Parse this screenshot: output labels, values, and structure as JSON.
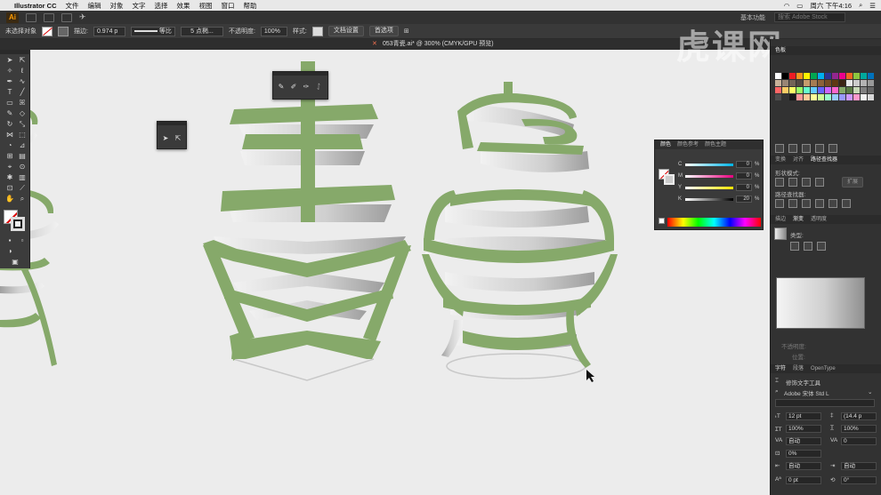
{
  "menubar": {
    "app_name": "Illustrator CC",
    "items": [
      "文件",
      "编辑",
      "对象",
      "文字",
      "选择",
      "效果",
      "视图",
      "窗口",
      "帮助"
    ],
    "clock": "周六 下午4:16"
  },
  "appbar": {
    "logo": "Ai",
    "workspace": "基本功能",
    "stock_placeholder": "搜索 Adobe Stock"
  },
  "controlbar": {
    "selection_status": "未选择对象",
    "stroke_label": "描边:",
    "stroke_value": "0.974 p",
    "profile": "等比",
    "brush": "5 点椭...",
    "opacity_label": "不透明度:",
    "opacity_value": "100%",
    "style_label": "样式:",
    "doc_setup": "文档设置",
    "preferences": "首选项"
  },
  "document": {
    "tab_title": "053青瓷.ai* @ 300% (CMYK/GPU 预览)",
    "close_glyph": "✕"
  },
  "watermark": "虎课网",
  "colors": {
    "ribbon_green": "#86a96a",
    "canvas_bg": "#ececec",
    "panel_bg": "#3a3a3a",
    "ai_orange": "#ff9a00"
  },
  "color_panel": {
    "tabs": [
      "颜色",
      "颜色参考",
      "颜色主题"
    ],
    "sliders": [
      {
        "label": "C",
        "value": "0",
        "unit": "%",
        "color": "#00b4e6"
      },
      {
        "label": "M",
        "value": "0",
        "unit": "%",
        "color": "#e6007e"
      },
      {
        "label": "Y",
        "value": "0",
        "unit": "%",
        "color": "#ffe600"
      },
      {
        "label": "K",
        "value": "20",
        "unit": "%",
        "color": "#333333"
      }
    ]
  },
  "right_dock": {
    "swatches_tab": "色板",
    "transform_tabs": [
      "变换",
      "对齐",
      "路径查找器"
    ],
    "shape_modes_label": "形状模式:",
    "expand_button": "扩展",
    "pathfinder_label": "路径查找器:",
    "gradient_tabs": [
      "描边",
      "渐变",
      "透明度"
    ],
    "gradient_type_label": "类型:",
    "opacity_label": "不透明度:",
    "location_label": "位置:",
    "char_tabs": [
      "字符",
      "段落",
      "OpenType"
    ],
    "touch_type_tool": "修饰文字工具",
    "font_family": "Adobe 宋体 Std L",
    "font_size": "12 pt",
    "leading": "(14.4 p",
    "hscale": "100%",
    "vscale": "100%",
    "kerning": "自动",
    "tracking": "0",
    "tsume": "0%",
    "aki_left": "自动",
    "aki_right": "自动",
    "baseline": "0 pt",
    "rotation": "0°"
  },
  "float_tools": {
    "brush_tools": [
      "paint-brush-icon",
      "blob-brush-icon",
      "shaper-icon",
      "pencil-icon"
    ],
    "select_tools": [
      "selection-arrow-icon",
      "direct-select-icon"
    ]
  }
}
